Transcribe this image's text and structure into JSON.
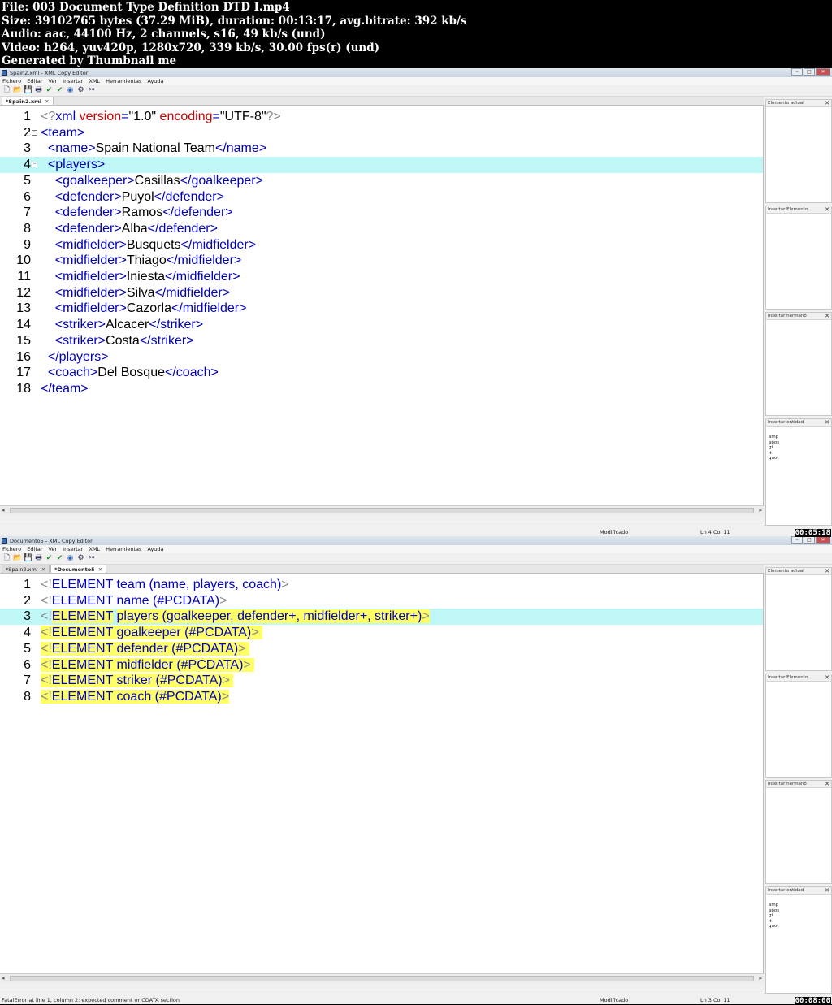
{
  "meta": {
    "file": "File: 003 Document Type Definition DTD I.mp4",
    "size": "Size: 39102765 bytes (37.29 MiB), duration: 00:13:17, avg.bitrate: 392 kb/s",
    "audio": "Audio: aac, 44100 Hz, 2 channels, s16, 49 kb/s (und)",
    "video": "Video: h264, yuv420p, 1280x720, 339 kb/s, 30.00 fps(r) (und)",
    "generated": "Generated by Thumbnail me"
  },
  "menu": [
    "Fichero",
    "Editar",
    "Ver",
    "Insertar",
    "XML",
    "Herramientas",
    "Ayuda"
  ],
  "window_buttons": {
    "minimize": "–",
    "maximize": "□",
    "close": "✕"
  },
  "side_panes": {
    "current_element": "Elemento actual",
    "insert_element": "Insertar Elemento",
    "insert_sibling": "Insertar hermano",
    "insert_entity": "Insertar entidad",
    "entities": [
      "amp",
      "apos",
      "gt",
      "lt",
      "quot"
    ]
  },
  "frame1": {
    "title": "Spain2.xml - XML Copy Editor",
    "tabs": [
      {
        "label": "*Spain2.xml",
        "active": true
      }
    ],
    "status": {
      "message": "",
      "state": "Modificado",
      "position": "Ln 4 Col 11"
    },
    "timestamp": "00:05:18",
    "current_line": 4,
    "lines": [
      {
        "n": "1",
        "html": "<span class=\"pi\">&lt;?</span><span class=\"t\">xml </span><span class=\"attr\">version</span><span class=\"t\">=</span><span class=\"txt\">\"1.0\" </span><span class=\"attr\">encoding</span><span class=\"t\">=</span><span class=\"txt\">\"UTF-8\"</span><span class=\"pi\">?&gt;</span>"
      },
      {
        "n": "2",
        "fold": true,
        "html": "<span class=\"t\">&lt;team&gt;</span>"
      },
      {
        "n": "3",
        "html": "  <span class=\"t\">&lt;name&gt;</span><span class=\"txt\">Spain National Team</span><span class=\"t\">&lt;/name&gt;</span>"
      },
      {
        "n": "4",
        "fold": true,
        "html": "  <span class=\"t\">&lt;players&gt;</span>"
      },
      {
        "n": "5",
        "html": "    <span class=\"t\">&lt;goalkeeper&gt;</span><span class=\"txt\">Casillas</span><span class=\"t\">&lt;/goalkeeper&gt;</span>"
      },
      {
        "n": "6",
        "html": "    <span class=\"t\">&lt;defender&gt;</span><span class=\"txt\">Puyol</span><span class=\"t\">&lt;/defender&gt;</span>"
      },
      {
        "n": "7",
        "html": "    <span class=\"t\">&lt;defender&gt;</span><span class=\"txt\">Ramos</span><span class=\"t\">&lt;/defender&gt;</span>"
      },
      {
        "n": "8",
        "html": "    <span class=\"t\">&lt;defender&gt;</span><span class=\"txt\">Alba</span><span class=\"t\">&lt;/defender&gt;</span>"
      },
      {
        "n": "9",
        "html": "    <span class=\"t\">&lt;midfielder&gt;</span><span class=\"txt\">Busquets</span><span class=\"t\">&lt;/midfielder&gt;</span>"
      },
      {
        "n": "10",
        "html": "    <span class=\"t\">&lt;midfielder&gt;</span><span class=\"txt\">Thiago</span><span class=\"t\">&lt;/midfielder&gt;</span>"
      },
      {
        "n": "11",
        "html": "    <span class=\"t\">&lt;midfielder&gt;</span><span class=\"txt\">Iniesta</span><span class=\"t\">&lt;/midfielder&gt;</span>"
      },
      {
        "n": "12",
        "html": "    <span class=\"t\">&lt;midfielder&gt;</span><span class=\"txt\">Silva</span><span class=\"t\">&lt;/midfielder&gt;</span>"
      },
      {
        "n": "13",
        "html": "    <span class=\"t\">&lt;midfielder&gt;</span><span class=\"txt\">Cazorla</span><span class=\"t\">&lt;/midfielder&gt;</span>"
      },
      {
        "n": "14",
        "html": "    <span class=\"t\">&lt;striker&gt;</span><span class=\"txt\">Alcacer</span><span class=\"t\">&lt;/striker&gt;</span>"
      },
      {
        "n": "15",
        "html": "    <span class=\"t\">&lt;striker&gt;</span><span class=\"txt\">Costa</span><span class=\"t\">&lt;/striker&gt;</span>"
      },
      {
        "n": "16",
        "html": "  <span class=\"t\">&lt;/players&gt;</span>"
      },
      {
        "n": "17",
        "html": "  <span class=\"t\">&lt;coach&gt;</span><span class=\"txt\">Del Bosque</span><span class=\"t\">&lt;/coach&gt;</span>"
      },
      {
        "n": "18",
        "html": "<span class=\"t\">&lt;/team&gt;</span>"
      }
    ]
  },
  "frame2": {
    "title": "Documento5 - XML Copy Editor",
    "tabs": [
      {
        "label": "*Spain2.xml",
        "active": false
      },
      {
        "label": "*Documento5",
        "active": true
      }
    ],
    "status": {
      "message": "FatalError at line 1, column 2: expected comment or CDATA section",
      "state": "Modificado",
      "position": "Ln 3 Col 11"
    },
    "timestamp": "00:08:00",
    "current_line": 3,
    "lines": [
      {
        "n": "1",
        "html": "<span class=\"pi\">&lt;!</span><span class=\"kw\">ELEMENT team (name, players, coach)</span><span class=\"pi\">&gt;</span>"
      },
      {
        "n": "2",
        "html": "<span class=\"pi\">&lt;!</span><span class=\"kw\">ELEMENT name (#PCDATA)</span><span class=\"pi\">&gt;</span>"
      },
      {
        "n": "3",
        "html": "<span class=\"pi\">&lt;!</span><span class=\"kw hl\">ELEMENT</span><span class=\"kw\"> </span><span class=\"kw hl\">players (goalkeeper, defender+, midfielder+, striker+)</span><span class=\"pi hl\">&gt;</span>"
      },
      {
        "n": "4",
        "html": "<span class=\"hl\"><span class=\"pi\">&lt;!</span><span class=\"kw\">ELEMENT goalkeeper (#PCDATA)</span><span class=\"pi\">&gt; </span></span>"
      },
      {
        "n": "5",
        "html": "<span class=\"hl\"><span class=\"pi\">&lt;!</span><span class=\"kw\">ELEMENT defender (#PCDATA)</span><span class=\"pi\">&gt; </span></span>"
      },
      {
        "n": "6",
        "html": "<span class=\"hl\"><span class=\"pi\">&lt;!</span><span class=\"kw\">ELEMENT midfielder (#PCDATA)</span><span class=\"pi\">&gt; </span></span>"
      },
      {
        "n": "7",
        "html": "<span class=\"hl\"><span class=\"pi\">&lt;!</span><span class=\"kw\">ELEMENT striker (#PCDATA)</span><span class=\"pi\">&gt; </span></span>"
      },
      {
        "n": "8",
        "html": "<span class=\"hl\"><span class=\"pi\">&lt;!</span><span class=\"kw\">ELEMENT coach (#PCDATA)</span><span class=\"pi\">&gt;</span></span>"
      }
    ]
  }
}
